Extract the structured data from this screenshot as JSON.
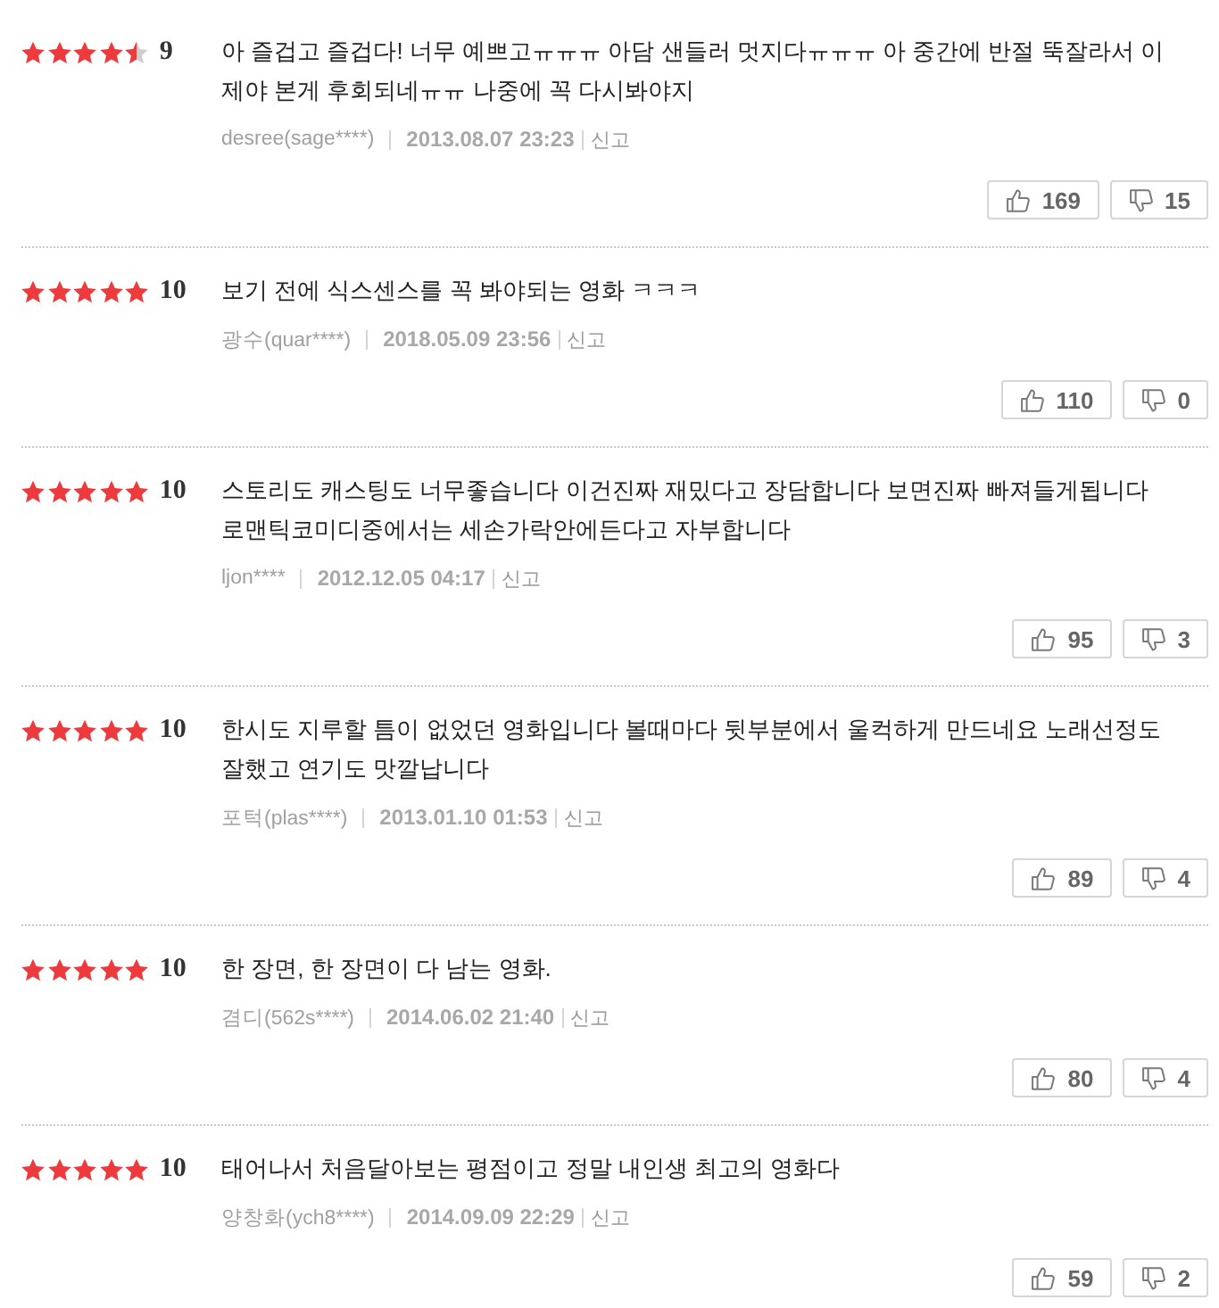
{
  "reviews": [
    {
      "stars": 4.5,
      "score": "9",
      "text": "아 즐겁고 즐겁다! 너무 예쁘고ㅠㅠㅠ 아담 샌들러 멋지다ㅠㅠㅠ 아 중간에 반절 뚝잘라서 이제야 본게 후회되네ㅠㅠ 나중에 꼭 다시봐야지",
      "author": "desree(sage****)",
      "date": "2013.08.07 23:23",
      "report": "신고",
      "likes": "169",
      "dislikes": "15"
    },
    {
      "stars": 5,
      "score": "10",
      "text": "보기 전에 식스센스를 꼭 봐야되는 영화 ㅋㅋㅋ",
      "author": "광수(quar****)",
      "date": "2018.05.09 23:56",
      "report": "신고",
      "likes": "110",
      "dislikes": "0"
    },
    {
      "stars": 5,
      "score": "10",
      "text": "스토리도 캐스팅도 너무좋습니다 이건진짜 재밌다고 장담합니다 보면진짜 빠져들게됩니다 로맨틱코미디중에서는 세손가락안에든다고 자부합니다",
      "author": "ljon****",
      "date": "2012.12.05 04:17",
      "report": "신고",
      "likes": "95",
      "dislikes": "3"
    },
    {
      "stars": 5,
      "score": "10",
      "text": "한시도 지루할 틈이 없었던 영화입니다 볼때마다 뒷부분에서 울컥하게 만드네요 노래선정도 잘했고 연기도 맛깔납니다",
      "author": "포턱(plas****)",
      "date": "2013.01.10 01:53",
      "report": "신고",
      "likes": "89",
      "dislikes": "4"
    },
    {
      "stars": 5,
      "score": "10",
      "text": "한 장면, 한 장면이 다 남는 영화.",
      "author": "겸디(562s****)",
      "date": "2014.06.02 21:40",
      "report": "신고",
      "likes": "80",
      "dislikes": "4"
    },
    {
      "stars": 5,
      "score": "10",
      "text": "태어나서 처음달아보는 평점이고 정말 내인생 최고의 영화다",
      "author": "양창화(ych8****)",
      "date": "2014.09.09 22:29",
      "report": "신고",
      "likes": "59",
      "dislikes": "2"
    }
  ]
}
